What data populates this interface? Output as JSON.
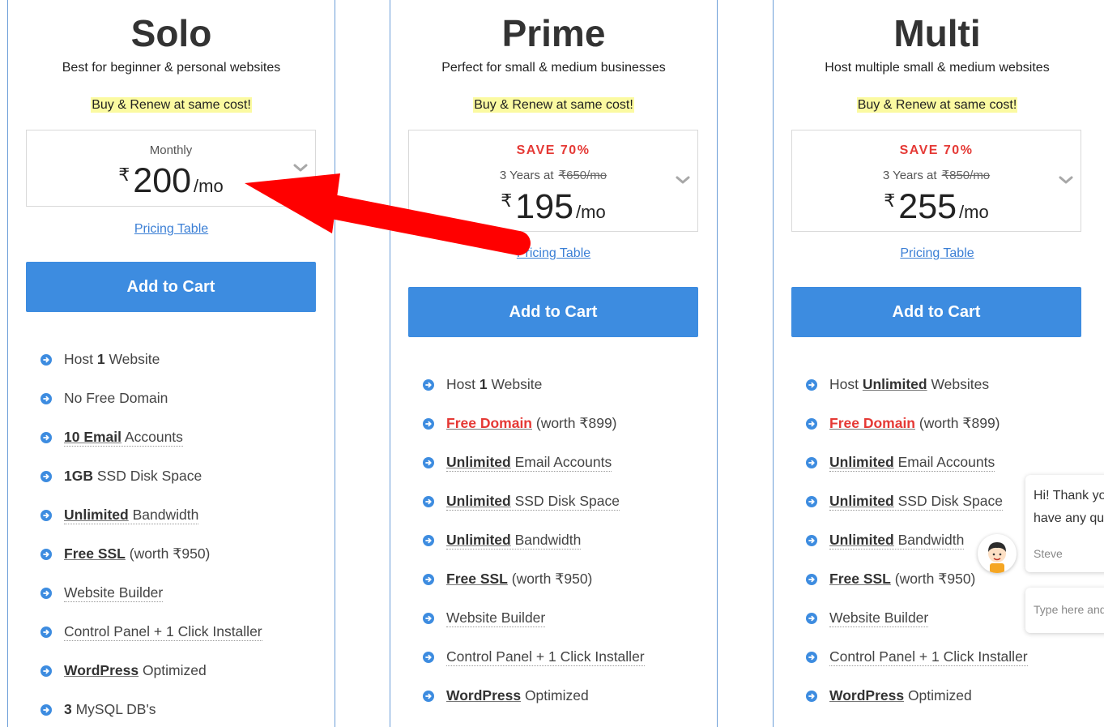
{
  "plans": [
    {
      "title": "Solo",
      "subtitle": "Best for beginner & personal websites",
      "promo": "Buy & Renew at same cost!",
      "billing_label": "Monthly",
      "currency": "₹",
      "price": "200",
      "per": "/mo",
      "pricing_link": "Pricing Table",
      "cta": "Add to Cart",
      "features": [
        {
          "parts": [
            {
              "t": "Host "
            },
            {
              "t": "1",
              "b": true
            },
            {
              "t": " Website"
            }
          ],
          "dotted": false
        },
        {
          "parts": [
            {
              "t": "No Free Domain"
            }
          ],
          "dotted": false
        },
        {
          "parts": [
            {
              "t": "10 Email",
              "b": true
            },
            {
              "t": " Accounts"
            }
          ],
          "dotted": true
        },
        {
          "parts": [
            {
              "t": "1GB",
              "b": true
            },
            {
              "t": " SSD Disk Space"
            }
          ],
          "dotted": false
        },
        {
          "parts": [
            {
              "t": "Unlimited",
              "b": true
            },
            {
              "t": " Bandwidth"
            }
          ],
          "dotted": true
        },
        {
          "parts": [
            {
              "t": "Free SSL",
              "b": true
            },
            {
              "t": " (worth ₹950)"
            }
          ],
          "dotted": false
        },
        {
          "parts": [
            {
              "t": "Website Builder"
            }
          ],
          "dotted": true
        },
        {
          "parts": [
            {
              "t": "Control Panel + 1 Click Installer"
            }
          ],
          "dotted": true
        },
        {
          "parts": [
            {
              "t": "WordPress",
              "b": true
            },
            {
              "t": " Optimized"
            }
          ],
          "dotted": false
        },
        {
          "parts": [
            {
              "t": "3",
              "b": true
            },
            {
              "t": " MySQL DB's"
            }
          ],
          "dotted": false
        }
      ]
    },
    {
      "title": "Prime",
      "subtitle": "Perfect for small & medium businesses",
      "promo": "Buy & Renew at same cost!",
      "save_label": "SAVE 70%",
      "years_label": "3 Years at",
      "old_price": "₹650/mo",
      "currency": "₹",
      "price": "195",
      "per": "/mo",
      "pricing_link": "Pricing Table",
      "cta": "Add to Cart",
      "features": [
        {
          "parts": [
            {
              "t": "Host "
            },
            {
              "t": "1",
              "b": true
            },
            {
              "t": " Website"
            }
          ],
          "dotted": false
        },
        {
          "parts": [
            {
              "t": "Free Domain",
              "b": true,
              "red": true
            },
            {
              "t": " (worth ₹899)"
            }
          ],
          "dotted": false
        },
        {
          "parts": [
            {
              "t": "Unlimited",
              "b": true
            },
            {
              "t": " Email Accounts"
            }
          ],
          "dotted": true
        },
        {
          "parts": [
            {
              "t": "Unlimited",
              "b": true
            },
            {
              "t": " SSD Disk Space"
            }
          ],
          "dotted": true
        },
        {
          "parts": [
            {
              "t": "Unlimited",
              "b": true
            },
            {
              "t": " Bandwidth"
            }
          ],
          "dotted": true
        },
        {
          "parts": [
            {
              "t": "Free SSL",
              "b": true
            },
            {
              "t": " (worth ₹950)"
            }
          ],
          "dotted": false
        },
        {
          "parts": [
            {
              "t": "Website Builder"
            }
          ],
          "dotted": true
        },
        {
          "parts": [
            {
              "t": "Control Panel + 1 Click Installer"
            }
          ],
          "dotted": true
        },
        {
          "parts": [
            {
              "t": "WordPress",
              "b": true
            },
            {
              "t": " Optimized"
            }
          ],
          "dotted": false
        }
      ]
    },
    {
      "title": "Multi",
      "subtitle": "Host multiple small & medium websites",
      "promo": "Buy & Renew at same cost!",
      "save_label": "SAVE 70%",
      "years_label": "3 Years at",
      "old_price": "₹850/mo",
      "currency": "₹",
      "price": "255",
      "per": "/mo",
      "pricing_link": "Pricing Table",
      "cta": "Add to Cart",
      "features": [
        {
          "parts": [
            {
              "t": "Host "
            },
            {
              "t": "Unlimited",
              "b": true
            },
            {
              "t": " Websites"
            }
          ],
          "dotted": false
        },
        {
          "parts": [
            {
              "t": "Free Domain",
              "b": true,
              "red": true
            },
            {
              "t": " (worth ₹899)"
            }
          ],
          "dotted": false
        },
        {
          "parts": [
            {
              "t": "Unlimited",
              "b": true
            },
            {
              "t": " Email Accounts"
            }
          ],
          "dotted": true
        },
        {
          "parts": [
            {
              "t": "Unlimited",
              "b": true
            },
            {
              "t": " SSD Disk Space"
            }
          ],
          "dotted": true
        },
        {
          "parts": [
            {
              "t": "Unlimited",
              "b": true
            },
            {
              "t": " Bandwidth"
            }
          ],
          "dotted": true
        },
        {
          "parts": [
            {
              "t": "Free SSL",
              "b": true
            },
            {
              "t": " (worth ₹950)"
            }
          ],
          "dotted": false
        },
        {
          "parts": [
            {
              "t": "Website Builder"
            }
          ],
          "dotted": true
        },
        {
          "parts": [
            {
              "t": "Control Panel + 1 Click Installer"
            }
          ],
          "dotted": true
        },
        {
          "parts": [
            {
              "t": "WordPress",
              "b": true
            },
            {
              "t": " Optimized"
            }
          ],
          "dotted": false
        }
      ]
    }
  ],
  "chat": {
    "message_line1": "Hi! Thank yo",
    "message_line2": "have any qu",
    "agent_name": "Steve",
    "input_placeholder": "Type here and"
  },
  "colors": {
    "accent": "#3d8ce0",
    "save_red": "#e53935",
    "promo_highlight": "#fbfaa1",
    "annotation_arrow": "#ff0000",
    "card_border": "#6c9ed8"
  },
  "icons": [
    "chevron-down-icon",
    "circle-arrow-right-icon",
    "agent-avatar-icon",
    "annotation-arrow"
  ]
}
